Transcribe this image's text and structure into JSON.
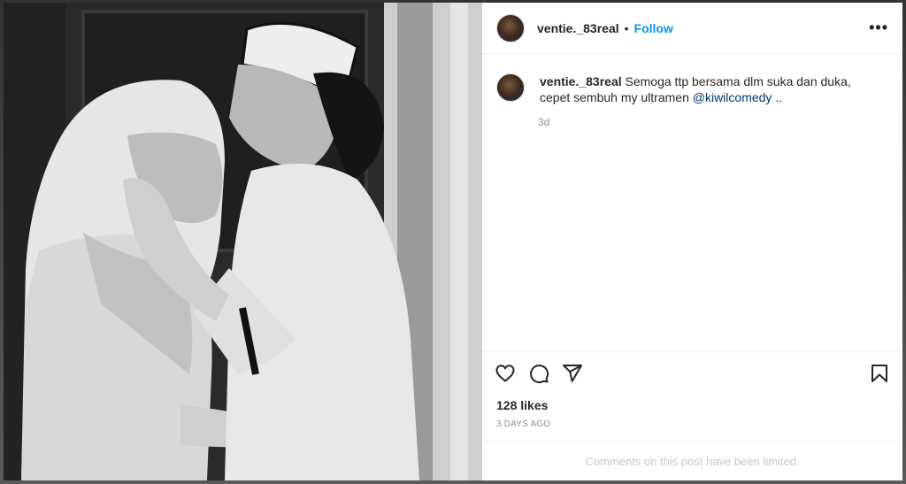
{
  "post": {
    "username": "ventie._83real",
    "follow_label": "Follow",
    "separator": "•",
    "more_label": "•••",
    "caption_user": "ventie._83real",
    "caption_text": " Semoga ttp bersama dlm suka dan duka, cepet sembuh my ultramen ",
    "caption_mention": "@kiwilcomedy",
    "caption_tail": " ..",
    "caption_time": "3d",
    "likes": "128 likes",
    "time_ago": "3 DAYS AGO",
    "comments_notice": "Comments on this post have been limited."
  },
  "icons": {
    "like": "heart-icon",
    "comment": "comment-icon",
    "share": "share-icon",
    "save": "bookmark-icon",
    "more": "more-options-icon"
  },
  "colors": {
    "accent": "#0095f6",
    "mention": "#00376b",
    "muted": "#8e8e8e"
  }
}
